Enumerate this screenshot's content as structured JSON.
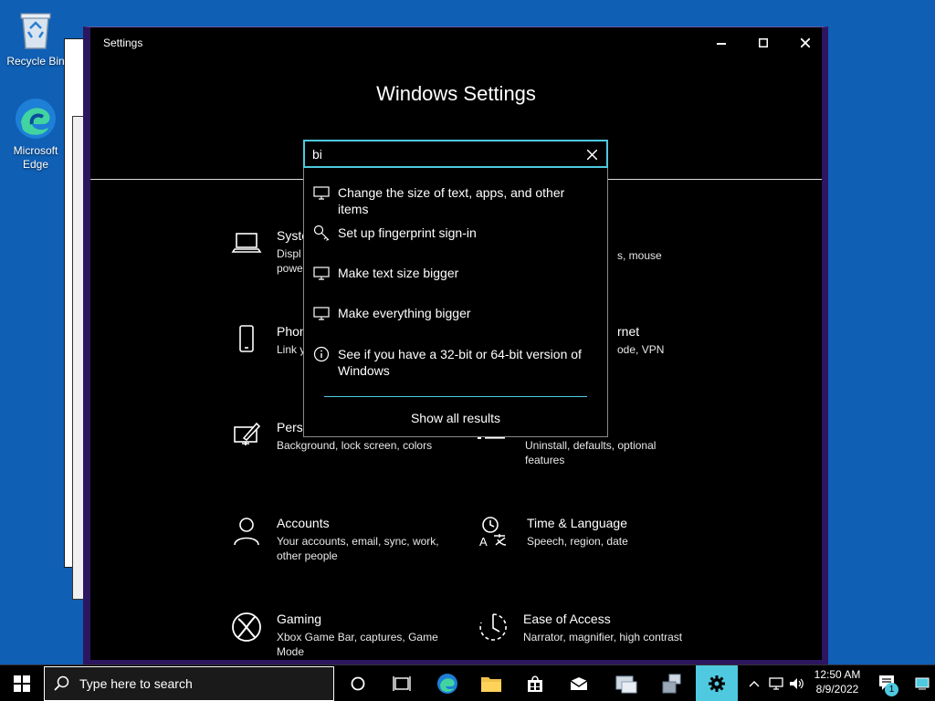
{
  "desktop": {
    "icons": [
      {
        "label": "Recycle Bin",
        "icon": "recycle-bin-icon"
      },
      {
        "label": "Microsoft Edge",
        "icon": "edge-icon"
      }
    ]
  },
  "window": {
    "title": "Settings",
    "controls": {
      "minimize": "minimize-icon",
      "maximize": "maximize-icon",
      "close": "close-icon"
    },
    "header": "Windows Settings"
  },
  "search": {
    "value": "bi",
    "suggestions": [
      {
        "icon": "monitor-icon",
        "text": "Change the size of text, apps, and other items"
      },
      {
        "icon": "key-icon",
        "text": "Set up fingerprint sign-in"
      },
      {
        "icon": "monitor-icon",
        "text": "Make text size bigger"
      },
      {
        "icon": "monitor-icon",
        "text": "Make everything bigger"
      },
      {
        "icon": "info-icon",
        "text": "See if you have a 32-bit or 64-bit version of Windows"
      }
    ],
    "show_all": "Show all results"
  },
  "categories": [
    {
      "name": "Syste",
      "desc": "Displ\npowe",
      "icon": "laptop-icon"
    },
    {
      "name": "",
      "desc": "s, mouse",
      "icon": ""
    },
    {
      "name": "Phon",
      "desc": "Link y",
      "icon": "phone-icon"
    },
    {
      "name": "rnet",
      "desc": "ode, VPN",
      "icon": ""
    },
    {
      "name": "Perso",
      "desc": "Background, lock screen, colors",
      "icon": "personalization-icon"
    },
    {
      "name": "",
      "desc": "Uninstall, defaults, optional features",
      "icon": "apps-icon"
    },
    {
      "name": "Accounts",
      "desc": "Your accounts, email, sync, work, other people",
      "icon": "person-icon"
    },
    {
      "name": "Time & Language",
      "desc": "Speech, region, date",
      "icon": "time-language-icon"
    },
    {
      "name": "Gaming",
      "desc": "Xbox Game Bar, captures, Game Mode",
      "icon": "xbox-icon"
    },
    {
      "name": "Ease of Access",
      "desc": "Narrator, magnifier, high contrast",
      "icon": "ease-of-access-icon"
    }
  ],
  "taskbar": {
    "search_placeholder": "Type here to search",
    "time": "12:50 AM",
    "date": "8/9/2022",
    "notification_count": "1",
    "accent": "#4fc9e0"
  }
}
